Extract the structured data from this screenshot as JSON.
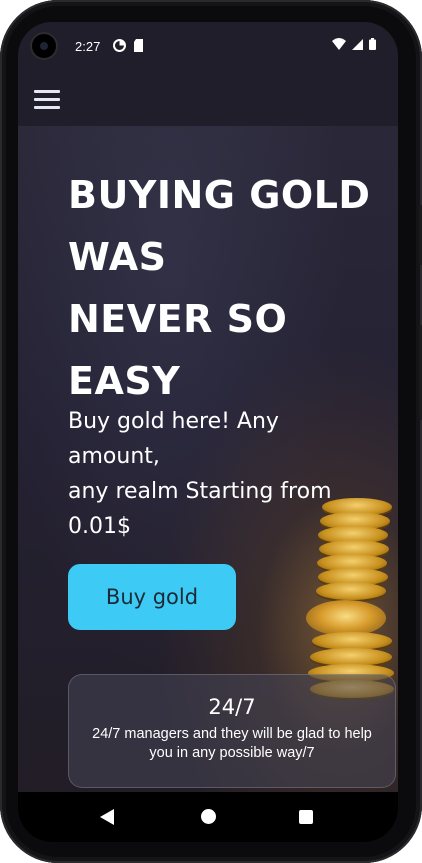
{
  "status_bar": {
    "time": "2:27",
    "left_icons": [
      "data-saver-icon",
      "sim-card-icon"
    ],
    "right_icons": [
      "wifi-icon",
      "signal-icon",
      "battery-icon"
    ]
  },
  "app_bar": {
    "menu_icon": "hamburger-menu-icon"
  },
  "hero": {
    "title_lines": [
      "BUYING GOLD",
      "WAS",
      "NEVER SO",
      "EASY"
    ],
    "subtitle_lines": [
      "Buy gold here! Any",
      "amount,",
      "any realm Starting from",
      "0.01$"
    ],
    "cta_label": "Buy gold",
    "colors": {
      "cta_background": "#3dcbf5",
      "cta_text": "#1b2a36",
      "title": "#ffffff"
    }
  },
  "feature_card": {
    "title": "24/7",
    "text": "24/7 managers and they will be glad to help you in any possible way/7"
  },
  "nav_bar": {
    "items": [
      "back-icon",
      "home-icon",
      "recents-icon"
    ]
  }
}
